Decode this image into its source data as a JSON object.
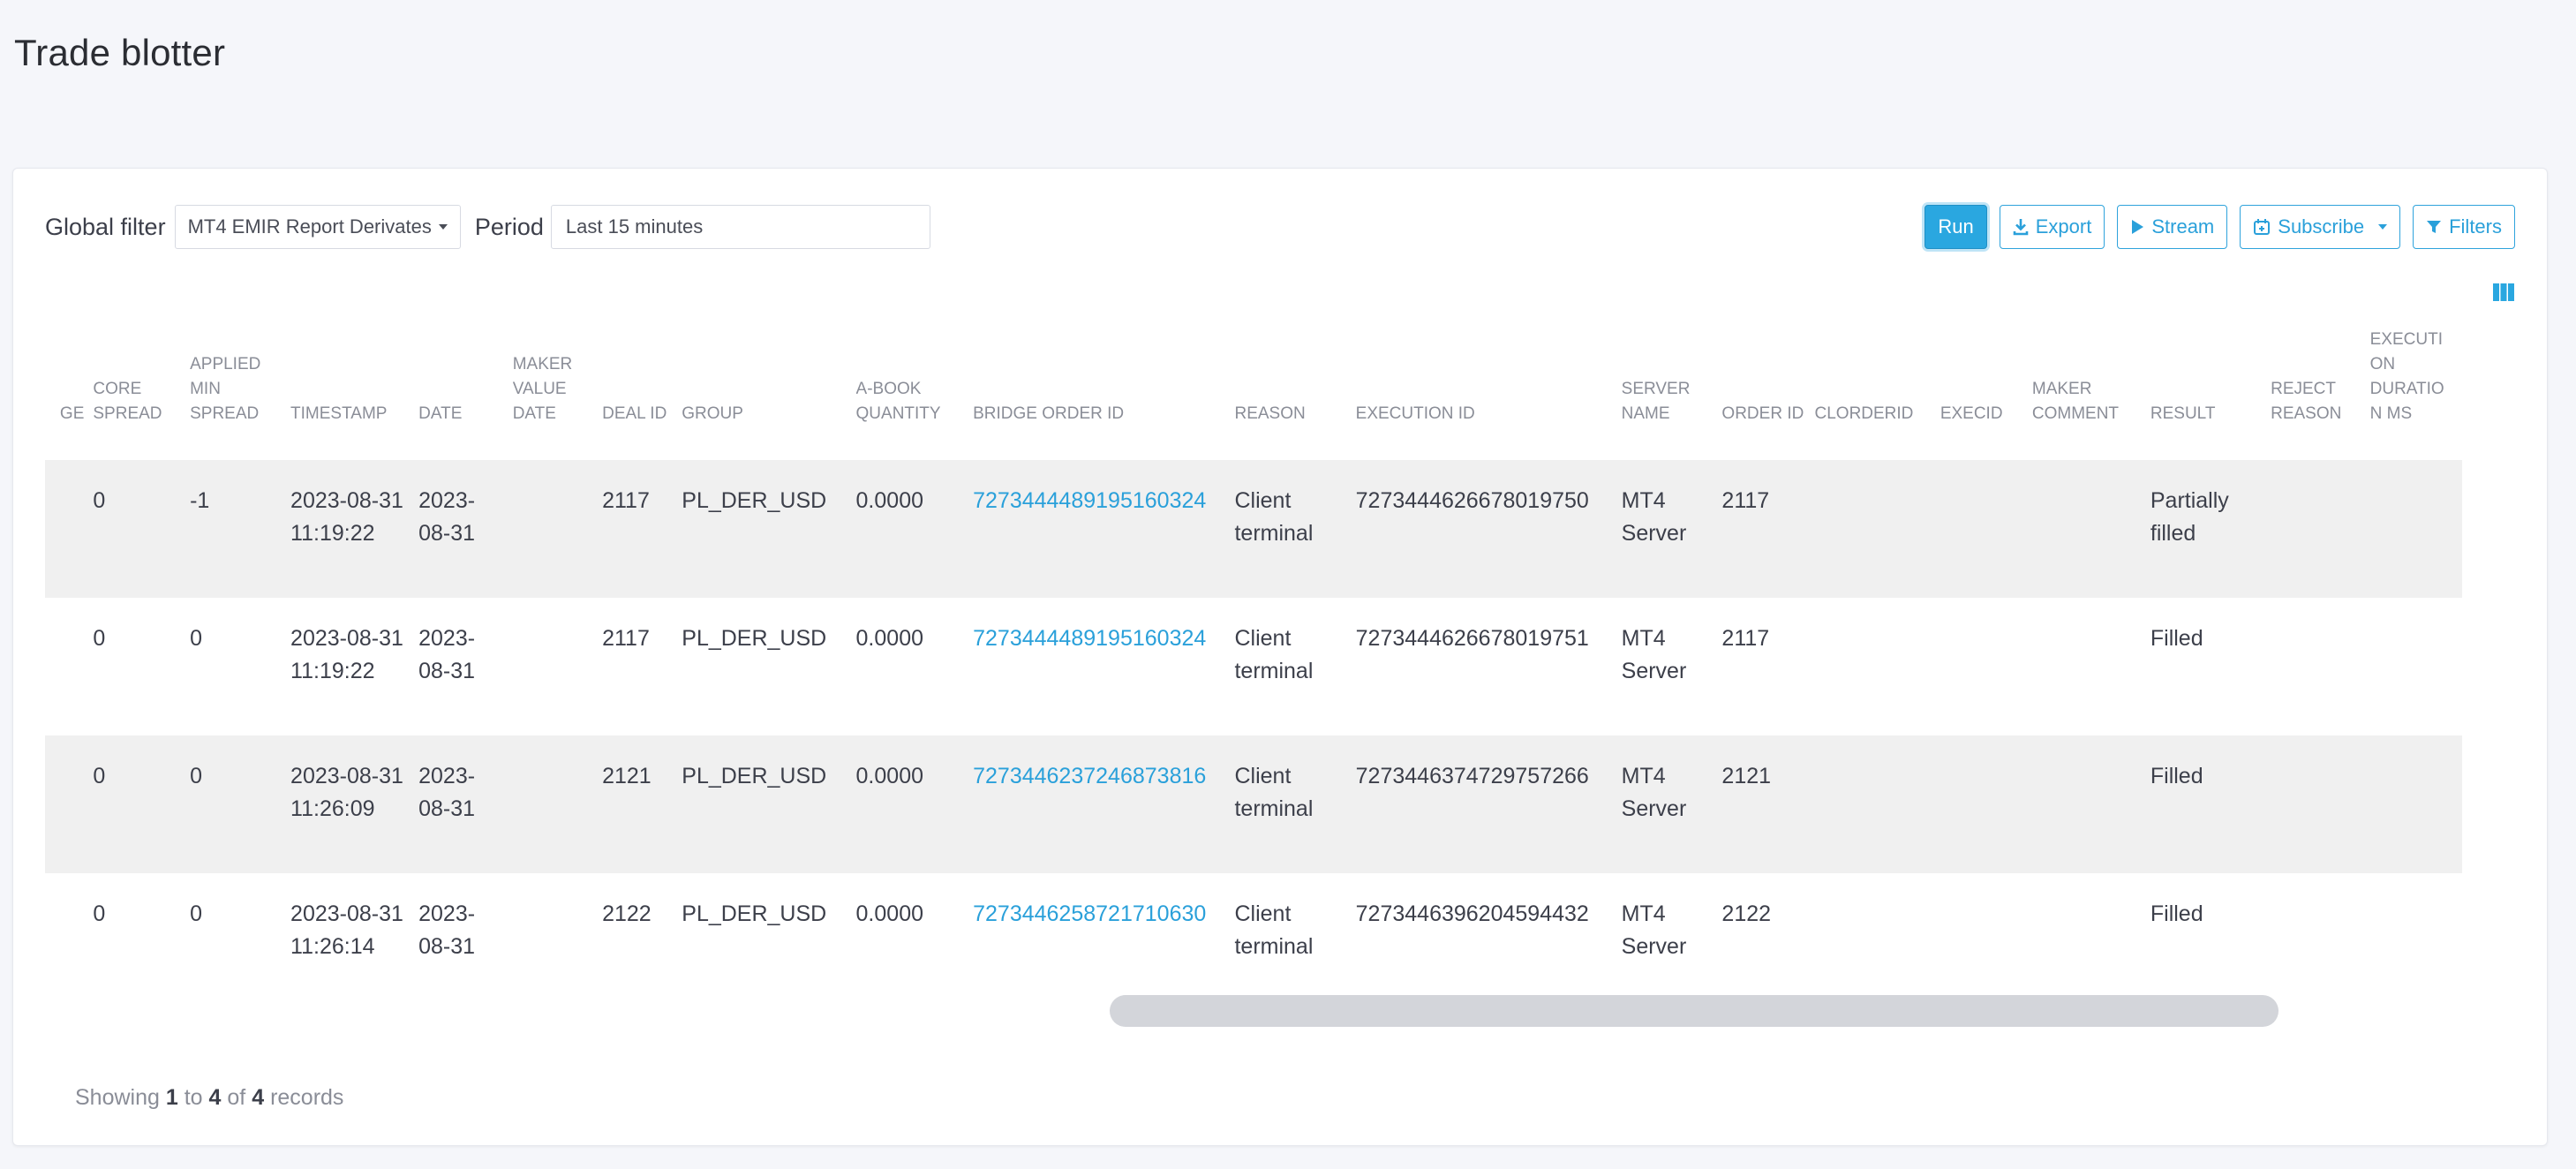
{
  "page": {
    "title": "Trade blotter"
  },
  "toolbar": {
    "global_filter_label": "Global filter",
    "global_filter_value": "MT4 EMIR Report Derivates",
    "period_label": "Period",
    "period_value": "Last 15 minutes",
    "buttons": {
      "run": "Run",
      "export": "Export",
      "stream": "Stream",
      "subscribe": "Subscribe",
      "filters": "Filters"
    }
  },
  "table": {
    "columns": [
      "GE",
      "CORE SPREAD",
      "APPLIED MIN SPREAD",
      "TIMESTAMP",
      "DATE",
      "MAKER VALUE DATE",
      "DEAL ID",
      "GROUP",
      "A-BOOK QUANTITY",
      "BRIDGE ORDER ID",
      "REASON",
      "EXECUTION ID",
      "SERVER NAME",
      "ORDER ID",
      "CLORDERID",
      "EXECID",
      "MAKER COMMENT",
      "RESULT",
      "REJECT REASON",
      "EXECUTION DURATION MS"
    ],
    "rows": [
      [
        "",
        "0",
        "-1",
        "2023-08-31 11:19:22",
        "2023-08-31",
        "",
        "2117",
        "PL_DER_USD",
        "0.0000",
        "7273444489195160324",
        "Client terminal",
        "7273444626678019750",
        "MT4 Server",
        "2117",
        "",
        "",
        "",
        "Partially filled",
        "",
        ""
      ],
      [
        "",
        "0",
        "0",
        "2023-08-31 11:19:22",
        "2023-08-31",
        "",
        "2117",
        "PL_DER_USD",
        "0.0000",
        "7273444489195160324",
        "Client terminal",
        "7273444626678019751",
        "MT4 Server",
        "2117",
        "",
        "",
        "",
        "Filled",
        "",
        ""
      ],
      [
        "",
        "0",
        "0",
        "2023-08-31 11:26:09",
        "2023-08-31",
        "",
        "2121",
        "PL_DER_USD",
        "0.0000",
        "7273446237246873816",
        "Client terminal",
        "7273446374729757266",
        "MT4 Server",
        "2121",
        "",
        "",
        "",
        "Filled",
        "",
        ""
      ],
      [
        "",
        "0",
        "0",
        "2023-08-31 11:26:14",
        "2023-08-31",
        "",
        "2122",
        "PL_DER_USD",
        "0.0000",
        "7273446258721710630",
        "Client terminal",
        "7273446396204594432",
        "MT4 Server",
        "2122",
        "",
        "",
        "",
        "Filled",
        "",
        ""
      ]
    ]
  },
  "footer": {
    "prefix": "Showing",
    "from": "1",
    "to_word": "to",
    "to": "4",
    "of_word": "of",
    "total": "4",
    "suffix": "records"
  },
  "colors": {
    "accent": "#2aa7e0",
    "link": "#2aa0da",
    "row_stripe": "#f0f0f0"
  },
  "icons": {
    "export": "download-icon",
    "stream": "play-icon",
    "subscribe": "calendar-add-icon",
    "filters": "filter-icon",
    "columns": "columns-icon"
  }
}
